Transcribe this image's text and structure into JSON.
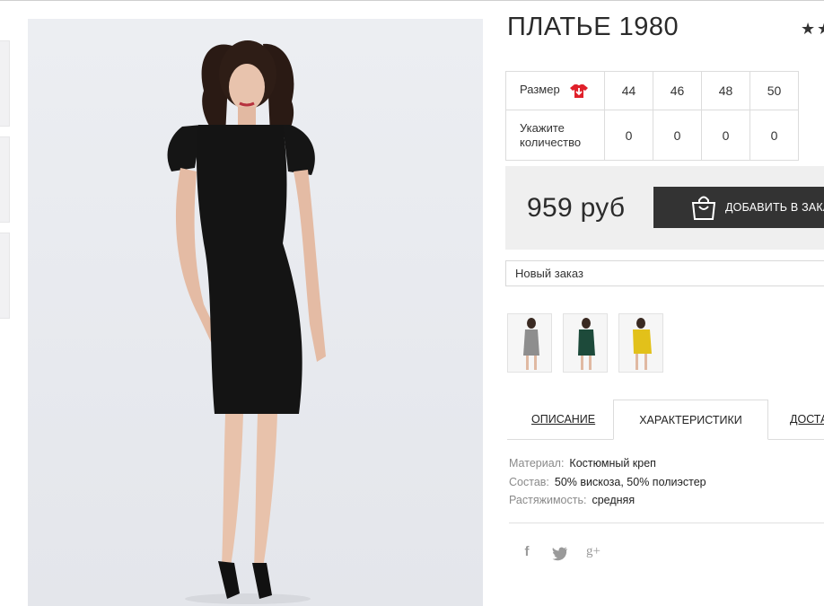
{
  "product": {
    "title": "ПЛАТЬЕ 1980",
    "stars": "★★"
  },
  "sizes": {
    "size_label": "Размер",
    "qty_label_line1": "Укажите",
    "qty_label_line2": "количество",
    "values": [
      "44",
      "46",
      "48",
      "50"
    ],
    "quantities": [
      "0",
      "0",
      "0",
      "0"
    ]
  },
  "price": {
    "amount": "959 руб",
    "add_button": "ДОБАВИТЬ В ЗАКАЗ"
  },
  "order": {
    "selected": "Новый заказ"
  },
  "color_variants": [
    {
      "name": "grey dress thumbnail",
      "color": "#8e8e8e"
    },
    {
      "name": "green dress thumbnail",
      "color": "#1d4a3a"
    },
    {
      "name": "yellow dress thumbnail",
      "color": "#e2c11a"
    }
  ],
  "tabs": {
    "description": "ОПИСАНИЕ",
    "characteristics": "ХАРАКТЕРИСТИКИ",
    "delivery": "ДОСТА"
  },
  "specs": [
    {
      "key": "Материал:",
      "value": "Костюмный креп"
    },
    {
      "key": "Состав:",
      "value": "50% вискоза, 50% полиэстер"
    },
    {
      "key": "Растяжимость:",
      "value": "средняя"
    }
  ],
  "social": {
    "facebook": "f",
    "twitter": "twitter-icon",
    "googleplus": "g+"
  },
  "colors": {
    "button_bg": "#333333",
    "price_bg": "#efefef",
    "dress": "#141414"
  }
}
